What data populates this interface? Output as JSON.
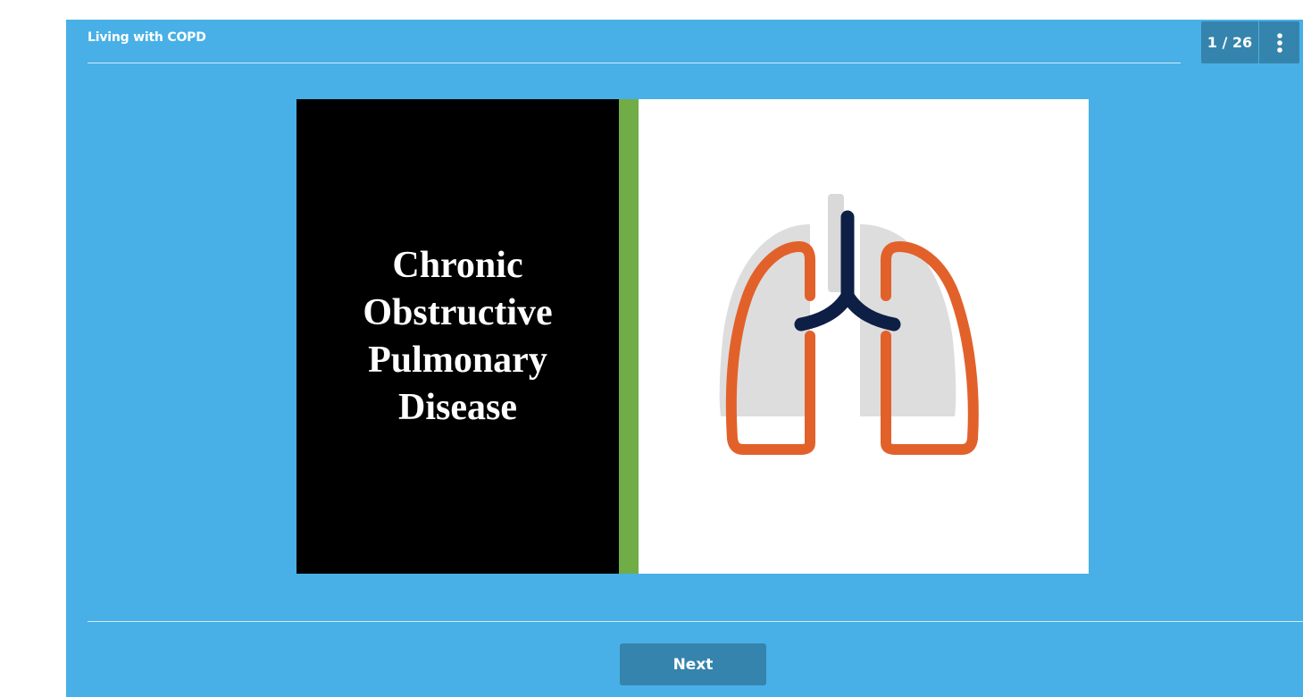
{
  "header": {
    "title": "Living with COPD",
    "slide_counter": "1 / 26",
    "menu_icon": "vertical-dots-icon"
  },
  "slide": {
    "heading_lines": [
      "Chronic",
      "Obstructive",
      "Pulmonary",
      "Disease"
    ],
    "image_icon": "lungs-icon",
    "colors": {
      "left_panel": "#000000",
      "accent_bar": "#70ad47",
      "lung_outline": "#e2612a",
      "trachea": "#0d1f45",
      "lung_shadow": "#d9d9d9"
    }
  },
  "footer": {
    "next_label": "Next"
  },
  "theme": {
    "background": "#48b0e6",
    "button": "#3584ad"
  }
}
